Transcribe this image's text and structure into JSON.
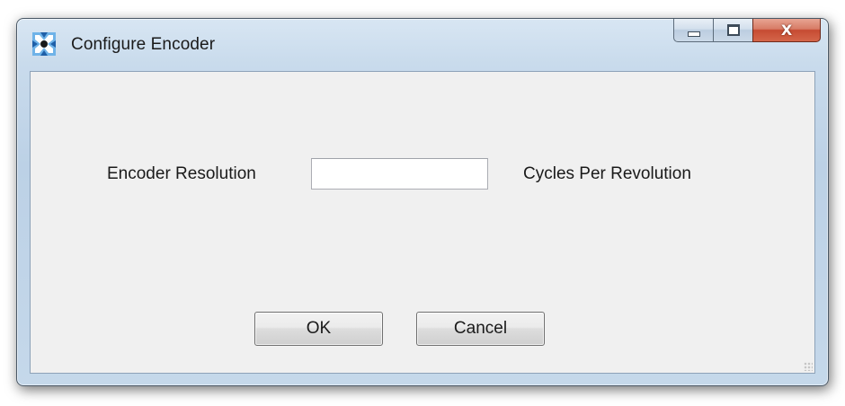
{
  "window": {
    "title": "Configure Encoder",
    "app_icon": "encoder-app-icon",
    "caption_buttons": {
      "minimize_icon": "minimize-icon",
      "maximize_icon": "maximize-icon",
      "close_glyph": "X"
    }
  },
  "form": {
    "resolution_label": "Encoder Resolution",
    "resolution_value": "",
    "resolution_unit": "Cycles Per Revolution"
  },
  "buttons": {
    "ok_label": "OK",
    "cancel_label": "Cancel"
  },
  "colors": {
    "frame": "#bcd1e6",
    "client": "#f0f0f0",
    "close_button": "#c64b32"
  }
}
